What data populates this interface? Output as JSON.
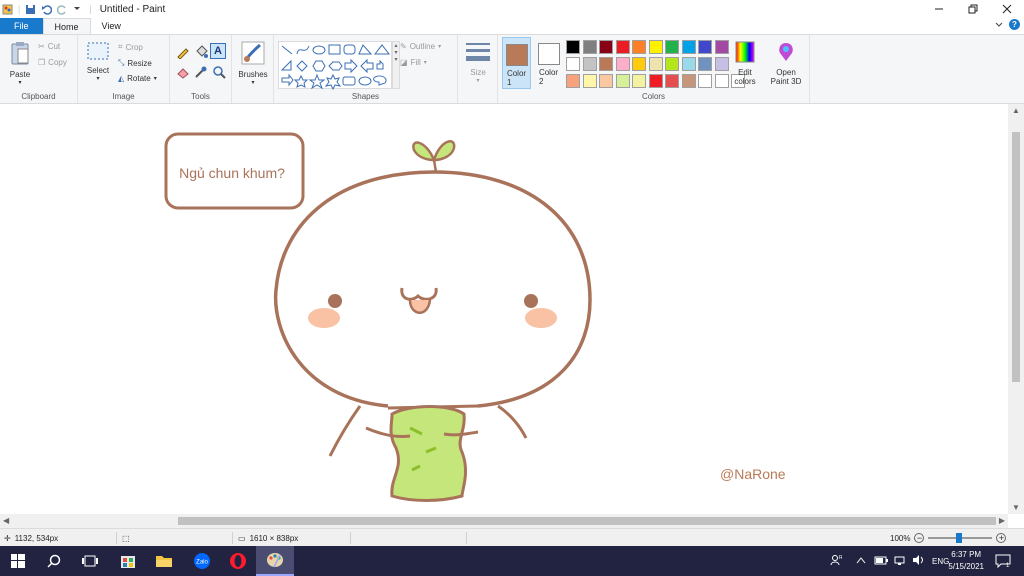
{
  "app": {
    "title": "Untitled - Paint"
  },
  "tabs": {
    "file": "File",
    "home": "Home",
    "view": "View"
  },
  "ribbon": {
    "clipboard": {
      "label": "Clipboard",
      "paste": "Paste",
      "cut": "Cut",
      "copy": "Copy"
    },
    "image": {
      "label": "Image",
      "select": "Select",
      "crop": "Crop",
      "resize": "Resize",
      "rotate": "Rotate"
    },
    "tools": {
      "label": "Tools"
    },
    "brushes": {
      "label": "Brushes"
    },
    "shapes": {
      "label": "Shapes",
      "outline": "Outline",
      "fill": "Fill"
    },
    "size": {
      "label": "Size"
    },
    "colors": {
      "label": "Colors",
      "color1": "Color 1",
      "color2": "Color 2",
      "edit": "Edit colors",
      "open3d": "Open Paint 3D",
      "color1_value": "#b97a57",
      "color2_value": "#ffffff",
      "palette_row1": [
        "#000000",
        "#7f7f7f",
        "#880015",
        "#ed1c24",
        "#ff7f27",
        "#fff200",
        "#22b14c",
        "#00a2e8",
        "#3f48cc",
        "#a349a4"
      ],
      "palette_row2": [
        "#ffffff",
        "#c3c3c3",
        "#b97a57",
        "#ffaec9",
        "#ffc90e",
        "#efe4b0",
        "#b5e61d",
        "#99d9ea",
        "#7092be",
        "#c8bfe7"
      ],
      "palette_row3": [
        "#f7a27a",
        "#fff6a8",
        "#f9c8a0",
        "#d6f09a",
        "#f2f2a0",
        "#ee1c24",
        "#e54e4e",
        "#c8967a",
        "#ffffff",
        "#ffffff",
        "#ffffff"
      ]
    }
  },
  "canvas": {
    "speech_text": "Ngủ chun khum?",
    "signature": "@NaRone",
    "outline_color": "#a8735a",
    "body_color": "#c4e67a",
    "cheek_color": "#f9c2a4",
    "eye_color": "#a8735a"
  },
  "status": {
    "cursor_pos": "1132, 534px",
    "canvas_size": "1610 × 838px",
    "zoom": "100%"
  },
  "taskbar": {
    "language": "ENG",
    "time": "6:37 PM",
    "date": "5/15/2021",
    "notif_count": "1"
  }
}
